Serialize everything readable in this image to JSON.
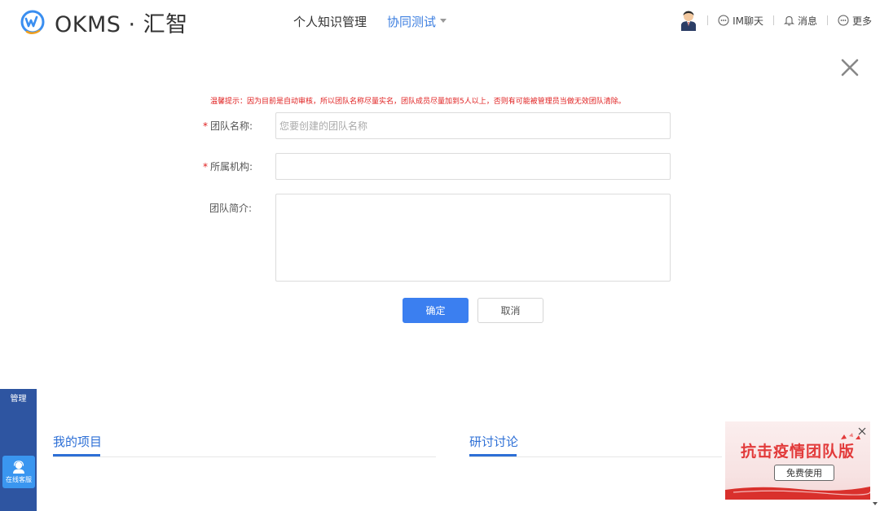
{
  "header": {
    "logo_text": "OKMS · 汇智",
    "nav": [
      {
        "label": "个人知识管理"
      },
      {
        "label": "协同测试"
      }
    ],
    "right": {
      "im_label": "IM聊天",
      "message_label": "消息",
      "more_label": "更多"
    }
  },
  "form": {
    "tip": "温馨提示：因为目前是自动审核，所以团队名称尽量实名，团队成员尽量加到5人以上，否则有可能被管理员当做无效团队清除。",
    "fields": {
      "team_name": {
        "label": "团队名称:",
        "placeholder": "您要创建的团队名称",
        "value": ""
      },
      "organization": {
        "label": "所属机构:",
        "placeholder": "",
        "value": ""
      },
      "intro": {
        "label": "团队简介:",
        "value": ""
      }
    },
    "required_mark": "*",
    "confirm_label": "确定",
    "cancel_label": "取消"
  },
  "sidebar": {
    "label": "管理",
    "service_label": "在线客服"
  },
  "sections": [
    {
      "title": "我的项目"
    },
    {
      "title": "研讨讨论"
    }
  ],
  "promo": {
    "title": "抗击疫情团队版",
    "button_label": "免费使用"
  },
  "colors": {
    "accent": "#3b7ff0",
    "nav_active": "#3d7fe0",
    "warning": "#e02020",
    "sidebar": "#2e55a1",
    "promo_red": "#e23a3a"
  }
}
